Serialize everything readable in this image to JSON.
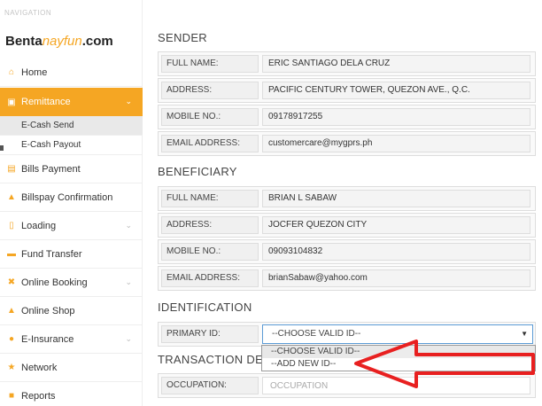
{
  "sidebar": {
    "caption": "NAVIGATION",
    "logo_main": "Benta",
    "logo_accent": "nayfun",
    "logo_tail": ".com",
    "items": [
      {
        "label": "Home",
        "icon": "home-icon"
      },
      {
        "label": "Remittance",
        "icon": "remittance-icon"
      },
      {
        "label": "Bills Payment",
        "icon": "bills-icon"
      },
      {
        "label": "Billspay Confirmation",
        "icon": "thumbs-up-icon"
      },
      {
        "label": "Loading",
        "icon": "mobile-icon"
      },
      {
        "label": "Fund Transfer",
        "icon": "credit-card-icon"
      },
      {
        "label": "Online Booking",
        "icon": "plane-icon"
      },
      {
        "label": "Online Shop",
        "icon": "cart-icon"
      },
      {
        "label": "E-Insurance",
        "icon": "user-icon"
      },
      {
        "label": "Network",
        "icon": "network-icon"
      },
      {
        "label": "Reports",
        "icon": "reports-icon"
      }
    ],
    "sub_items": [
      "E-Cash Send",
      "E-Cash Payout"
    ],
    "accent_color": "#f5a623"
  },
  "sender": {
    "title": "SENDER",
    "full_name_label": "FULL NAME:",
    "full_name": "ERIC SANTIAGO DELA CRUZ",
    "address_label": "ADDRESS:",
    "address": "PACIFIC CENTURY TOWER, QUEZON AVE., Q.C.",
    "mobile_label": "MOBILE NO.:",
    "mobile": "09178917255",
    "email_label": "EMAIL ADDRESS:",
    "email": "customercare@mygprs.ph"
  },
  "beneficiary": {
    "title": "BENEFICIARY",
    "full_name_label": "FULL NAME:",
    "full_name": "BRIAN L SABAW",
    "address_label": "ADDRESS:",
    "address": "JOCFER QUEZON CITY",
    "mobile_label": "MOBILE NO.:",
    "mobile": "09093104832",
    "email_label": "EMAIL ADDRESS:",
    "email": "brianSabaw@yahoo.com"
  },
  "identification": {
    "title": "IDENTIFICATION",
    "primary_id_label": "PRIMARY ID:",
    "selected": "--CHOOSE VALID ID--",
    "options": [
      "--CHOOSE VALID ID--",
      "--ADD NEW ID--"
    ]
  },
  "transaction": {
    "title": "TRANSACTION DET",
    "occupation_label": "OCCUPATION:",
    "occupation_placeholder": "OCCUPATION"
  }
}
